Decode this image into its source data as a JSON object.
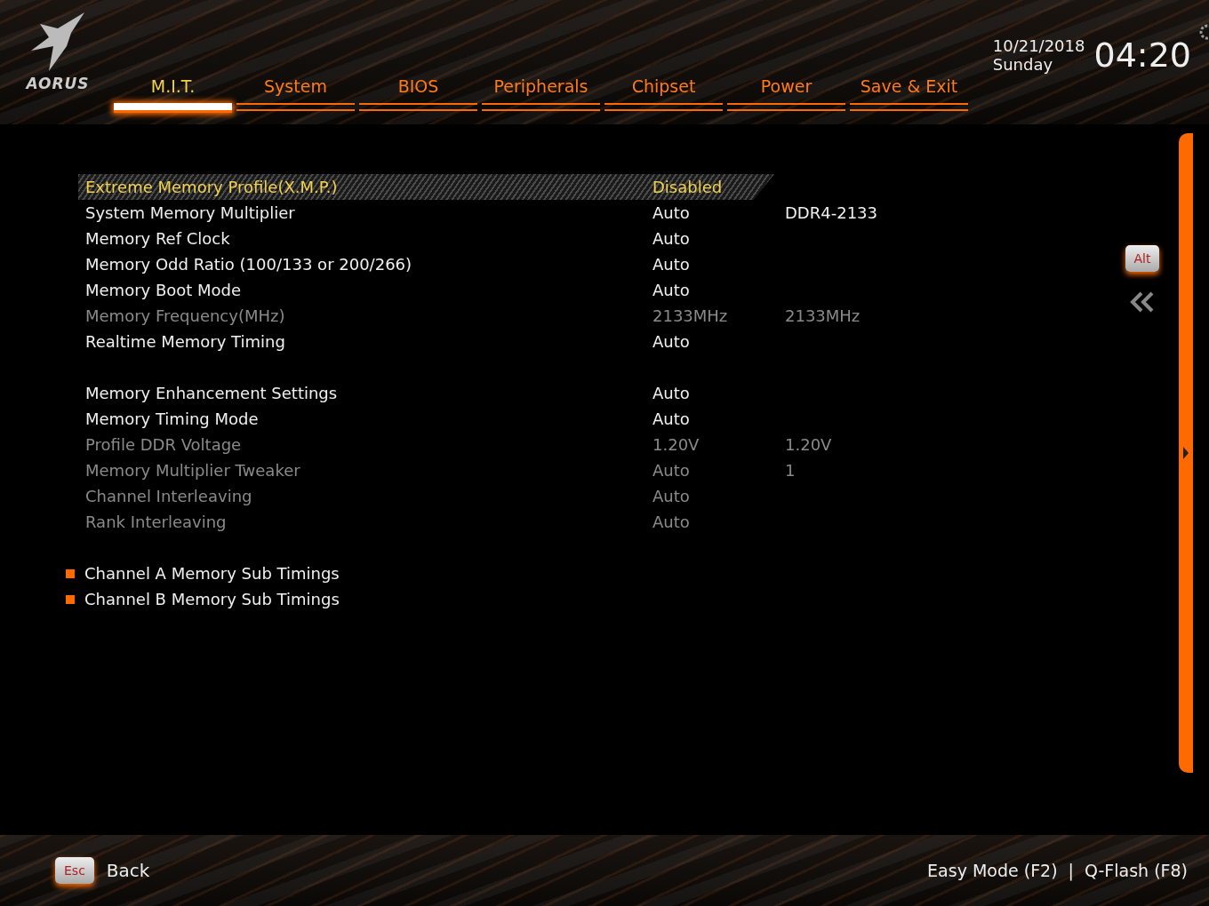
{
  "logo_text": "AORUS",
  "tabs": [
    {
      "label": "M.I.T.",
      "selected": true
    },
    {
      "label": "System",
      "selected": false
    },
    {
      "label": "BIOS",
      "selected": false
    },
    {
      "label": "Peripherals",
      "selected": false
    },
    {
      "label": "Chipset",
      "selected": false
    },
    {
      "label": "Power",
      "selected": false
    },
    {
      "label": "Save & Exit",
      "selected": false
    }
  ],
  "clock": {
    "date": "10/21/2018",
    "day": "Sunday",
    "time": "04:20"
  },
  "groups": [
    [
      {
        "label": "Extreme Memory Profile(X.M.P.)",
        "value": "Disabled",
        "selected": true,
        "disabled": false
      },
      {
        "label": "System Memory Multiplier",
        "value": "Auto",
        "value_2": "DDR4-2133",
        "selected": false,
        "disabled": false
      },
      {
        "label": "Memory Ref Clock",
        "value": "Auto",
        "selected": false,
        "disabled": false
      },
      {
        "label": "Memory Odd Ratio (100/133 or 200/266)",
        "value": "Auto",
        "selected": false,
        "disabled": false
      },
      {
        "label": "Memory Boot Mode",
        "value": "Auto",
        "selected": false,
        "disabled": false
      },
      {
        "label": "Memory Frequency(MHz)",
        "value": "2133MHz",
        "value_2": "2133MHz",
        "selected": false,
        "disabled": true
      },
      {
        "label": "Realtime Memory Timing",
        "value": "Auto",
        "selected": false,
        "disabled": false
      }
    ],
    [
      {
        "label": "Memory Enhancement Settings",
        "value": "Auto",
        "selected": false,
        "disabled": false
      },
      {
        "label": "Memory Timing Mode",
        "value": "Auto",
        "selected": false,
        "disabled": false
      },
      {
        "label": "Profile DDR Voltage",
        "value": "1.20V",
        "value_2": "1.20V",
        "selected": false,
        "disabled": true
      },
      {
        "label": "Memory Multiplier Tweaker",
        "value": "Auto",
        "value_2": "1",
        "selected": false,
        "disabled": true
      },
      {
        "label": "Channel Interleaving",
        "value": "Auto",
        "selected": false,
        "disabled": true
      },
      {
        "label": "Rank Interleaving",
        "value": "Auto",
        "selected": false,
        "disabled": true
      }
    ]
  ],
  "submenus": [
    "Channel A Memory Sub Timings",
    "Channel B Memory Sub Timings"
  ],
  "side_key": "Alt",
  "footer": {
    "key": "Esc",
    "back": "Back",
    "shortcuts": [
      "Easy Mode (F2)",
      "Q-Flash (F8)"
    ],
    "separator": "|"
  }
}
